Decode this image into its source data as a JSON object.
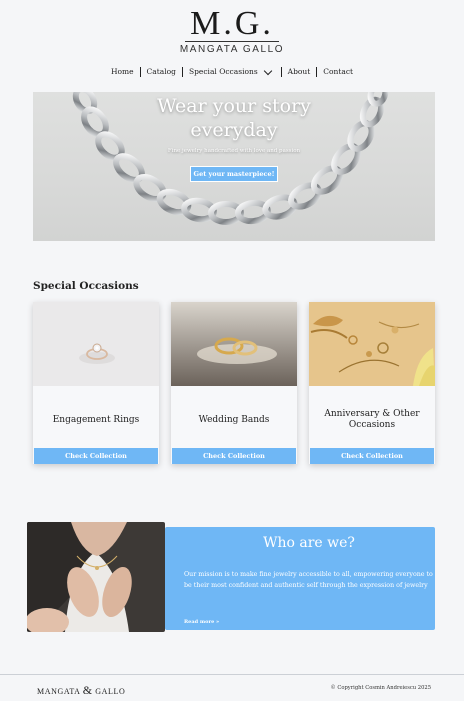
{
  "logo": {
    "mark": "M.G.",
    "subtitle": "MANGATA GALLO"
  },
  "nav": {
    "items": [
      {
        "label": "Home"
      },
      {
        "label": "Catalog"
      },
      {
        "label": "Special Occasions",
        "has_dropdown": true
      },
      {
        "label": "About"
      },
      {
        "label": "Contact"
      }
    ]
  },
  "hero": {
    "title_line1": "Wear your story",
    "title_line2": "everyday",
    "subtitle": "Fine jewelry handcrafted with love and passion",
    "cta_label": "Get your masterpiece!"
  },
  "special_occasions": {
    "heading": "Special Occasions",
    "cards": [
      {
        "title": "Engagement Rings",
        "button": "Check Collection"
      },
      {
        "title": "Wedding Bands",
        "button": "Check Collection"
      },
      {
        "title": "Anniversary & Other Occasions",
        "button": "Check Collection"
      }
    ]
  },
  "about": {
    "title": "Who are we?",
    "text": "Our mission is to make fine jewelry accessible to all, empowering everyone to be their most confident and authentic self through the expression of jewelry",
    "link": "Read more »"
  },
  "footer": {
    "brand_left": "Mangata",
    "brand_amp": "&",
    "brand_right": "Gallo",
    "copyright": "© Copyright Cosmin Andreiescu 2025"
  },
  "colors": {
    "accent": "#6fb7f5",
    "background": "#f5f6f8"
  }
}
